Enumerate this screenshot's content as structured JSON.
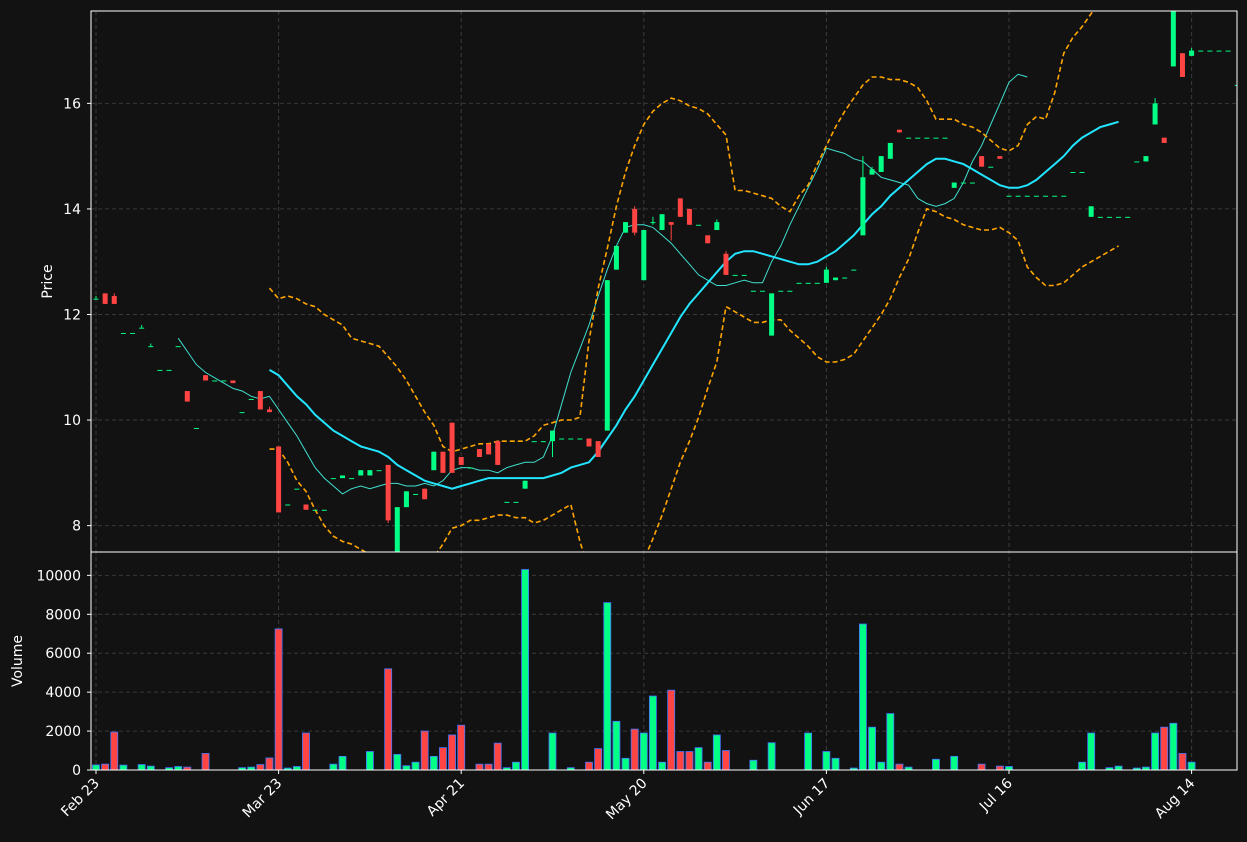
{
  "chart_data": {
    "type": "candlestick",
    "style": {
      "background": "#121212",
      "up_color": "#00ff84",
      "down_color": "#ff4444",
      "volume_edge": "#4477ff",
      "grid": "#3a3a3a",
      "text": "#ffffff",
      "frame": "#ffffff",
      "bollinger_color": "#ffa500",
      "ma_fast_color": "#40e0d0",
      "ma_slow_color": "#22e5ff"
    },
    "panels": [
      {
        "id": "price",
        "ylabel": "Price",
        "ylim": [
          7.5,
          17.75
        ],
        "yticks": [
          8,
          10,
          12,
          14,
          16
        ],
        "grid": true
      },
      {
        "id": "volume",
        "ylabel": "Volume",
        "ylim": [
          0,
          11200
        ],
        "yticks": [
          0,
          2000,
          4000,
          6000,
          8000,
          10000
        ],
        "grid": true
      }
    ],
    "x_axis": {
      "start_date": "Feb 23",
      "ticks": [
        {
          "i": 0,
          "label": "Feb 23"
        },
        {
          "i": 20,
          "label": "Mar 23"
        },
        {
          "i": 40,
          "label": "Apr 21"
        },
        {
          "i": 60,
          "label": "May 20"
        },
        {
          "i": 80,
          "label": "Jun 17"
        },
        {
          "i": 100,
          "label": "Jul 16"
        },
        {
          "i": 120,
          "label": "Aug 14"
        }
      ],
      "label_rotation": 45
    },
    "candles": [
      [
        12.3,
        12.35,
        12.3,
        12.3,
        260
      ],
      [
        12.4,
        12.4,
        12.2,
        12.2,
        300
      ],
      [
        12.35,
        12.4,
        12.2,
        12.2,
        1950
      ],
      [
        11.65,
        11.65,
        11.65,
        11.65,
        250
      ],
      [
        11.65,
        11.65,
        11.65,
        11.65,
        0
      ],
      [
        11.75,
        11.8,
        11.75,
        11.75,
        280
      ],
      [
        11.4,
        11.45,
        11.4,
        11.4,
        200
      ],
      [
        10.95,
        10.95,
        10.95,
        10.95,
        0
      ],
      [
        10.95,
        10.95,
        10.95,
        10.95,
        120
      ],
      [
        11.4,
        11.4,
        11.4,
        11.4,
        180
      ],
      [
        10.55,
        10.55,
        10.35,
        10.35,
        150
      ],
      [
        9.85,
        9.85,
        9.85,
        9.85,
        0
      ],
      [
        10.85,
        10.85,
        10.75,
        10.75,
        850
      ],
      [
        10.75,
        10.75,
        10.75,
        10.75,
        0
      ],
      [
        10.75,
        10.75,
        10.75,
        10.75,
        0
      ],
      [
        10.75,
        10.75,
        10.7,
        10.7,
        0
      ],
      [
        10.15,
        10.15,
        10.15,
        10.15,
        120
      ],
      [
        10.4,
        10.4,
        10.4,
        10.4,
        150
      ],
      [
        10.55,
        10.55,
        10.2,
        10.2,
        280
      ],
      [
        10.2,
        10.25,
        10.15,
        10.15,
        620
      ],
      [
        9.5,
        9.5,
        8.25,
        8.25,
        7250
      ],
      [
        8.4,
        8.4,
        8.4,
        8.4,
        100
      ],
      [
        8.7,
        8.7,
        8.7,
        8.7,
        180
      ],
      [
        8.4,
        8.4,
        8.3,
        8.3,
        1900
      ],
      [
        8.3,
        8.3,
        8.3,
        8.3,
        0
      ],
      [
        8.3,
        8.3,
        8.3,
        8.3,
        0
      ],
      [
        8.9,
        8.9,
        8.9,
        8.9,
        300
      ],
      [
        8.9,
        8.95,
        8.9,
        8.95,
        700
      ],
      [
        8.9,
        8.9,
        8.9,
        8.9,
        0
      ],
      [
        8.95,
        9.05,
        8.95,
        9.05,
        0
      ],
      [
        8.95,
        9.05,
        8.95,
        9.05,
        950
      ],
      [
        9.05,
        9.05,
        9.05,
        9.05,
        0
      ],
      [
        9.15,
        9.15,
        8.05,
        8.1,
        5200
      ],
      [
        7.45,
        8.35,
        7.45,
        8.35,
        800
      ],
      [
        8.35,
        8.65,
        8.35,
        8.65,
        220
      ],
      [
        8.6,
        8.6,
        8.6,
        8.6,
        400
      ],
      [
        8.7,
        8.7,
        8.5,
        8.5,
        2000
      ],
      [
        9.05,
        9.4,
        9.05,
        9.4,
        700
      ],
      [
        9.4,
        9.4,
        9.0,
        9.0,
        1150
      ],
      [
        9.95,
        9.95,
        9.0,
        9.0,
        1800
      ],
      [
        9.3,
        9.3,
        9.15,
        9.15,
        2300
      ],
      [
        9.1,
        9.1,
        9.1,
        9.1,
        0
      ],
      [
        9.45,
        9.45,
        9.3,
        9.3,
        300
      ],
      [
        9.55,
        9.55,
        9.35,
        9.35,
        300
      ],
      [
        9.6,
        9.6,
        9.15,
        9.15,
        1380
      ],
      [
        8.45,
        8.45,
        8.45,
        8.45,
        120
      ],
      [
        8.45,
        8.45,
        8.45,
        8.45,
        400
      ],
      [
        8.7,
        8.85,
        8.7,
        8.85,
        10300
      ],
      [
        9.6,
        9.6,
        9.6,
        9.6,
        0
      ],
      [
        9.6,
        9.6,
        9.6,
        9.6,
        0
      ],
      [
        9.6,
        9.8,
        9.3,
        9.8,
        1900
      ],
      [
        9.65,
        9.65,
        9.65,
        9.65,
        0
      ],
      [
        9.65,
        9.65,
        9.65,
        9.65,
        120
      ],
      [
        9.65,
        9.65,
        9.65,
        9.65,
        0
      ],
      [
        9.65,
        9.65,
        9.5,
        9.5,
        400
      ],
      [
        9.6,
        9.6,
        9.3,
        9.3,
        1100
      ],
      [
        9.8,
        12.65,
        9.8,
        12.65,
        8600
      ],
      [
        12.85,
        13.3,
        12.85,
        13.3,
        2500
      ],
      [
        13.55,
        13.75,
        13.55,
        13.75,
        600
      ],
      [
        14.0,
        14.05,
        13.5,
        13.55,
        2100
      ],
      [
        12.65,
        13.6,
        12.65,
        13.6,
        1900
      ],
      [
        13.75,
        13.85,
        13.7,
        13.75,
        3800
      ],
      [
        13.6,
        13.9,
        13.6,
        13.9,
        400
      ],
      [
        13.75,
        13.75,
        13.4,
        13.7,
        4100
      ],
      [
        14.2,
        14.2,
        13.85,
        13.85,
        950
      ],
      [
        14.0,
        14.0,
        13.7,
        13.7,
        950
      ],
      [
        13.7,
        13.7,
        13.7,
        13.7,
        1150
      ],
      [
        13.5,
        13.5,
        13.35,
        13.35,
        400
      ],
      [
        13.6,
        13.8,
        13.6,
        13.75,
        1800
      ],
      [
        13.15,
        13.2,
        12.75,
        12.75,
        1000
      ],
      [
        12.75,
        12.75,
        12.75,
        12.75,
        0
      ],
      [
        12.75,
        12.75,
        12.75,
        12.75,
        0
      ],
      [
        12.45,
        12.45,
        12.45,
        12.45,
        500
      ],
      [
        12.45,
        12.45,
        12.45,
        12.45,
        0
      ],
      [
        11.6,
        12.4,
        11.6,
        12.4,
        1400
      ],
      [
        12.45,
        12.45,
        12.45,
        12.45,
        0
      ],
      [
        12.45,
        12.45,
        12.45,
        12.45,
        0
      ],
      [
        12.6,
        12.6,
        12.6,
        12.6,
        0
      ],
      [
        12.6,
        12.6,
        12.6,
        12.6,
        1900
      ],
      [
        12.6,
        12.6,
        12.6,
        12.6,
        0
      ],
      [
        12.6,
        12.9,
        12.6,
        12.85,
        950
      ],
      [
        12.65,
        12.7,
        12.65,
        12.7,
        600
      ],
      [
        12.7,
        12.7,
        12.7,
        12.7,
        0
      ],
      [
        12.85,
        12.85,
        12.85,
        12.85,
        100
      ],
      [
        13.5,
        15.0,
        13.5,
        14.6,
        7500
      ],
      [
        14.65,
        14.8,
        14.65,
        14.75,
        2200
      ],
      [
        14.7,
        15.0,
        14.7,
        15.0,
        400
      ],
      [
        14.95,
        15.25,
        14.95,
        15.25,
        2900
      ],
      [
        15.5,
        15.5,
        15.45,
        15.45,
        300
      ],
      [
        15.35,
        15.35,
        15.35,
        15.35,
        150
      ],
      [
        15.35,
        15.35,
        15.35,
        15.35,
        0
      ],
      [
        15.35,
        15.35,
        15.35,
        15.35,
        0
      ],
      [
        15.35,
        15.35,
        15.35,
        15.35,
        550
      ],
      [
        15.35,
        15.35,
        15.35,
        15.35,
        0
      ],
      [
        14.4,
        14.5,
        14.4,
        14.5,
        700
      ],
      [
        14.5,
        14.5,
        14.5,
        14.5,
        0
      ],
      [
        14.5,
        14.5,
        14.5,
        14.5,
        0
      ],
      [
        15.0,
        15.0,
        14.8,
        14.8,
        300
      ],
      [
        14.8,
        14.8,
        14.8,
        14.8,
        0
      ],
      [
        15.0,
        15.0,
        14.95,
        14.95,
        200
      ],
      [
        14.25,
        14.25,
        14.25,
        14.25,
        180
      ],
      [
        14.25,
        14.25,
        14.25,
        14.25,
        0
      ],
      [
        14.25,
        14.25,
        14.25,
        14.25,
        0
      ],
      [
        14.25,
        14.25,
        14.25,
        14.25,
        0
      ],
      [
        14.25,
        14.25,
        14.25,
        14.25,
        0
      ],
      [
        14.25,
        14.25,
        14.25,
        14.25,
        0
      ],
      [
        14.25,
        14.25,
        14.25,
        14.25,
        0
      ],
      [
        14.7,
        14.7,
        14.7,
        14.7,
        0
      ],
      [
        14.7,
        14.7,
        14.7,
        14.7,
        400
      ],
      [
        13.85,
        14.05,
        13.85,
        14.05,
        1900
      ],
      [
        13.85,
        13.85,
        13.85,
        13.85,
        0
      ],
      [
        13.85,
        13.85,
        13.85,
        13.85,
        120
      ],
      [
        13.85,
        13.85,
        13.85,
        13.85,
        200
      ],
      [
        13.85,
        13.85,
        13.85,
        13.85,
        0
      ],
      [
        14.9,
        14.9,
        14.9,
        14.9,
        100
      ],
      [
        14.9,
        15.0,
        14.9,
        15.0,
        150
      ],
      [
        15.6,
        16.1,
        15.6,
        16.0,
        1900
      ],
      [
        15.35,
        15.35,
        15.25,
        15.25,
        2200
      ],
      [
        16.7,
        17.75,
        16.7,
        17.75,
        2400
      ],
      [
        16.95,
        16.95,
        16.5,
        16.5,
        850
      ],
      [
        16.9,
        17.05,
        16.9,
        17.0,
        400
      ],
      [
        17.0,
        17.0,
        17.0,
        17.0,
        0
      ],
      [
        17.0,
        17.0,
        17.0,
        17.0,
        0
      ],
      [
        17.0,
        17.0,
        17.0,
        17.0,
        0
      ],
      [
        17.0,
        17.0,
        17.0,
        17.0,
        0
      ],
      [
        16.35,
        16.35,
        16.35,
        16.35,
        0
      ],
      [
        16.35,
        16.35,
        16.35,
        16.35,
        150
      ],
      [
        15.65,
        15.65,
        15.65,
        15.65,
        400
      ],
      [
        15.8,
        15.8,
        15.55,
        15.55,
        650
      ]
    ],
    "overlays": [
      {
        "name": "ma_fast",
        "role": "moving_average_fast",
        "start": 9,
        "values": [
          11.55,
          11.3,
          11.05,
          10.9,
          10.8,
          10.7,
          10.6,
          10.55,
          10.45,
          10.4,
          10.45,
          10.2,
          9.95,
          9.7,
          9.4,
          9.1,
          8.9,
          8.75,
          8.6,
          8.7,
          8.75,
          8.7,
          8.75,
          8.8,
          8.8,
          8.75,
          8.75,
          8.8,
          8.75,
          8.85,
          9.05,
          9.1,
          9.1,
          9.05,
          9.05,
          9.0,
          9.1,
          9.15,
          9.2,
          9.2,
          9.3,
          9.7,
          10.3,
          10.9,
          11.35,
          11.8,
          12.35,
          12.85,
          13.3,
          13.65,
          13.7,
          13.7,
          13.65,
          13.5,
          13.35,
          13.15,
          12.95,
          12.75,
          12.65,
          12.55,
          12.55,
          12.6,
          12.65,
          12.6,
          12.6,
          13.0,
          13.3,
          13.7,
          14.05,
          14.4,
          14.75,
          15.15,
          15.1,
          15.05,
          14.95,
          14.9,
          14.75,
          14.6,
          14.55,
          14.5,
          14.45,
          14.2,
          14.1,
          14.05,
          14.1,
          14.2,
          14.5,
          14.9,
          15.2,
          15.6,
          16.0,
          16.4,
          16.55,
          16.5
        ]
      },
      {
        "name": "ma_slow",
        "role": "moving_average_slow",
        "start": 19,
        "values": [
          10.95,
          10.85,
          10.65,
          10.45,
          10.3,
          10.1,
          9.95,
          9.8,
          9.7,
          9.6,
          9.5,
          9.45,
          9.4,
          9.3,
          9.15,
          9.05,
          8.95,
          8.85,
          8.8,
          8.75,
          8.7,
          8.75,
          8.8,
          8.85,
          8.9,
          8.9,
          8.9,
          8.9,
          8.9,
          8.9,
          8.9,
          8.95,
          9.0,
          9.1,
          9.15,
          9.2,
          9.4,
          9.65,
          9.9,
          10.2,
          10.45,
          10.75,
          11.05,
          11.35,
          11.65,
          11.95,
          12.2,
          12.4,
          12.6,
          12.8,
          13.0,
          13.15,
          13.2,
          13.2,
          13.15,
          13.1,
          13.05,
          13.0,
          12.95,
          12.95,
          13.0,
          13.1,
          13.2,
          13.35,
          13.5,
          13.7,
          13.9,
          14.05,
          14.25,
          14.4,
          14.55,
          14.7,
          14.85,
          14.95,
          14.95,
          14.9,
          14.85,
          14.75,
          14.65,
          14.55,
          14.45,
          14.4,
          14.4,
          14.45,
          14.55,
          14.7,
          14.85,
          15.0,
          15.2,
          15.35,
          15.45,
          15.55,
          15.6,
          15.65
        ]
      },
      {
        "name": "bb_upper",
        "role": "bollinger_upper",
        "start": 19,
        "values": [
          12.5,
          12.3,
          12.35,
          12.3,
          12.2,
          12.15,
          12.0,
          11.9,
          11.8,
          11.55,
          11.5,
          11.45,
          11.4,
          11.2,
          11.0,
          10.75,
          10.45,
          10.15,
          9.9,
          9.5,
          9.4,
          9.45,
          9.5,
          9.55,
          9.55,
          9.6,
          9.6,
          9.6,
          9.6,
          9.7,
          9.9,
          9.95,
          10.0,
          10.0,
          10.05,
          11.5,
          12.5,
          13.25,
          14.05,
          14.7,
          15.2,
          15.6,
          15.85,
          16.0,
          16.1,
          16.05,
          15.95,
          15.9,
          15.8,
          15.6,
          15.4,
          14.35,
          14.35,
          14.3,
          14.25,
          14.2,
          14.05,
          13.95,
          14.25,
          14.45,
          14.85,
          15.2,
          15.55,
          15.85,
          16.1,
          16.35,
          16.5,
          16.5,
          16.45,
          16.45,
          16.4,
          16.3,
          16.05,
          15.7,
          15.7,
          15.7,
          15.6,
          15.55,
          15.45,
          15.3,
          15.15,
          15.1,
          15.2,
          15.6,
          15.75,
          15.7,
          16.2,
          16.95,
          17.25,
          17.45,
          17.7,
          17.95,
          18.1,
          18.2
        ]
      },
      {
        "name": "bb_lower",
        "role": "bollinger_lower",
        "start": 19,
        "values": [
          9.45,
          9.45,
          9.2,
          8.85,
          8.65,
          8.3,
          8.0,
          7.8,
          7.7,
          7.65,
          7.55,
          7.45,
          7.35,
          7.3,
          7.25,
          7.25,
          7.25,
          7.3,
          7.4,
          7.65,
          7.95,
          8.0,
          8.1,
          8.1,
          8.15,
          8.2,
          8.2,
          8.15,
          8.15,
          8.05,
          8.1,
          8.2,
          8.3,
          8.4,
          7.7,
          7.15,
          6.55,
          6.35,
          6.45,
          6.65,
          6.95,
          7.35,
          7.75,
          8.2,
          8.7,
          9.2,
          9.6,
          10.05,
          10.6,
          11.1,
          12.15,
          12.05,
          11.95,
          11.85,
          11.85,
          11.9,
          11.9,
          11.7,
          11.55,
          11.4,
          11.2,
          11.1,
          11.1,
          11.15,
          11.25,
          11.5,
          11.75,
          12.0,
          12.3,
          12.7,
          13.05,
          13.55,
          14.0,
          13.95,
          13.85,
          13.8,
          13.7,
          13.65,
          13.6,
          13.6,
          13.65,
          13.55,
          13.4,
          12.9,
          12.7,
          12.55,
          12.55,
          12.6,
          12.75,
          12.9,
          13.0,
          13.1,
          13.2,
          13.3
        ]
      }
    ]
  }
}
